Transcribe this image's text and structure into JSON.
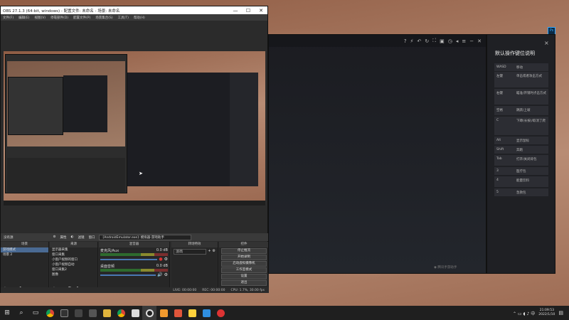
{
  "obs": {
    "title": "OBS 27.1.3 (64-bit, windows) - 配置文件: 未命名 - 场景: 未命名",
    "window_controls": [
      "—",
      "☐",
      "✕"
    ],
    "menu": [
      "文件(F)",
      "编辑(E)",
      "视图(V)",
      "停靠部件(D)",
      "配置文件(P)",
      "场景集合(S)",
      "工具(T)",
      "帮助(H)"
    ],
    "dock_bar": {
      "scene_label": "没有源",
      "properties": "属性",
      "filters": "滤镜",
      "window": "窗口",
      "source_value": "[AndroidEmulator.exe]: 模拟器-游戏助手"
    },
    "scenes": {
      "header": "场景",
      "items": [
        "游戏模式",
        "场景 2"
      ]
    },
    "sources": {
      "header": "来源",
      "items": [
        "显示器采集",
        "窗口采集",
        "小窗户视频的窗口",
        "小窗户视频自动",
        "窗口采集2",
        "图像"
      ]
    },
    "mixer": {
      "header": "混音器",
      "tracks": [
        {
          "name": "麦克风/Aux",
          "db": "0.0 dB"
        },
        {
          "name": "桌面音频",
          "db": "0.0 dB"
        }
      ]
    },
    "transitions": {
      "header": "转场特效",
      "value": "淡出"
    },
    "controls": {
      "header": "控件",
      "buttons": [
        "停止推流",
        "开始录制",
        "启动虚拟摄像机",
        "工作室模式",
        "设置",
        "退出"
      ]
    },
    "status": {
      "live": "LIVE: 00:00:00",
      "rec": "REC: 00:00:00",
      "cpu": "CPU: 1.7%, 30.00 fps"
    }
  },
  "emulator": {
    "toolbar_icons": [
      "help-icon",
      "flash-icon",
      "undo-icon",
      "rotate-icon",
      "fullscreen-icon",
      "window-icon",
      "clock-icon",
      "collapse-icon",
      "menu-icon",
      "minimize-icon",
      "close-icon"
    ],
    "watermark": "腾讯手游助手"
  },
  "keypanel": {
    "title": "默认操作键位说明",
    "close": "×",
    "rows": [
      {
        "key": "WASD",
        "desc": "移动"
      },
      {
        "key": "左键",
        "desc": "单击或者攻击方式"
      },
      {
        "key": "右键",
        "desc": "瞄准/开镜时点击方式"
      },
      {
        "key": "空格",
        "desc": "跳跃/上坡"
      },
      {
        "key": "C",
        "desc": "下蹲(长按)/取消了爬"
      },
      {
        "key": "Alt",
        "desc": "显示鼠标"
      },
      {
        "key": "Shift",
        "desc": "奔跑"
      },
      {
        "key": "Tab",
        "desc": "打开/关闭背包"
      },
      {
        "key": "3",
        "desc": "医疗包"
      },
      {
        "key": "4",
        "desc": "能量饮料"
      },
      {
        "key": "5",
        "desc": "急救包"
      }
    ]
  },
  "desktop": {
    "ps_icon_label": "Ps"
  },
  "taskbar": {
    "icons": [
      "start-icon",
      "search-icon",
      "task-view-icon",
      "chrome-icon",
      "explorer-icon",
      "app-icon",
      "g-icon",
      "folder-icon",
      "chrome2-icon",
      "app2-icon",
      "obs-icon",
      "app3-icon",
      "app4-icon",
      "app5-icon",
      "app6-icon",
      "app7-icon"
    ],
    "time": "21:09:53",
    "date": "2022/1/10"
  }
}
